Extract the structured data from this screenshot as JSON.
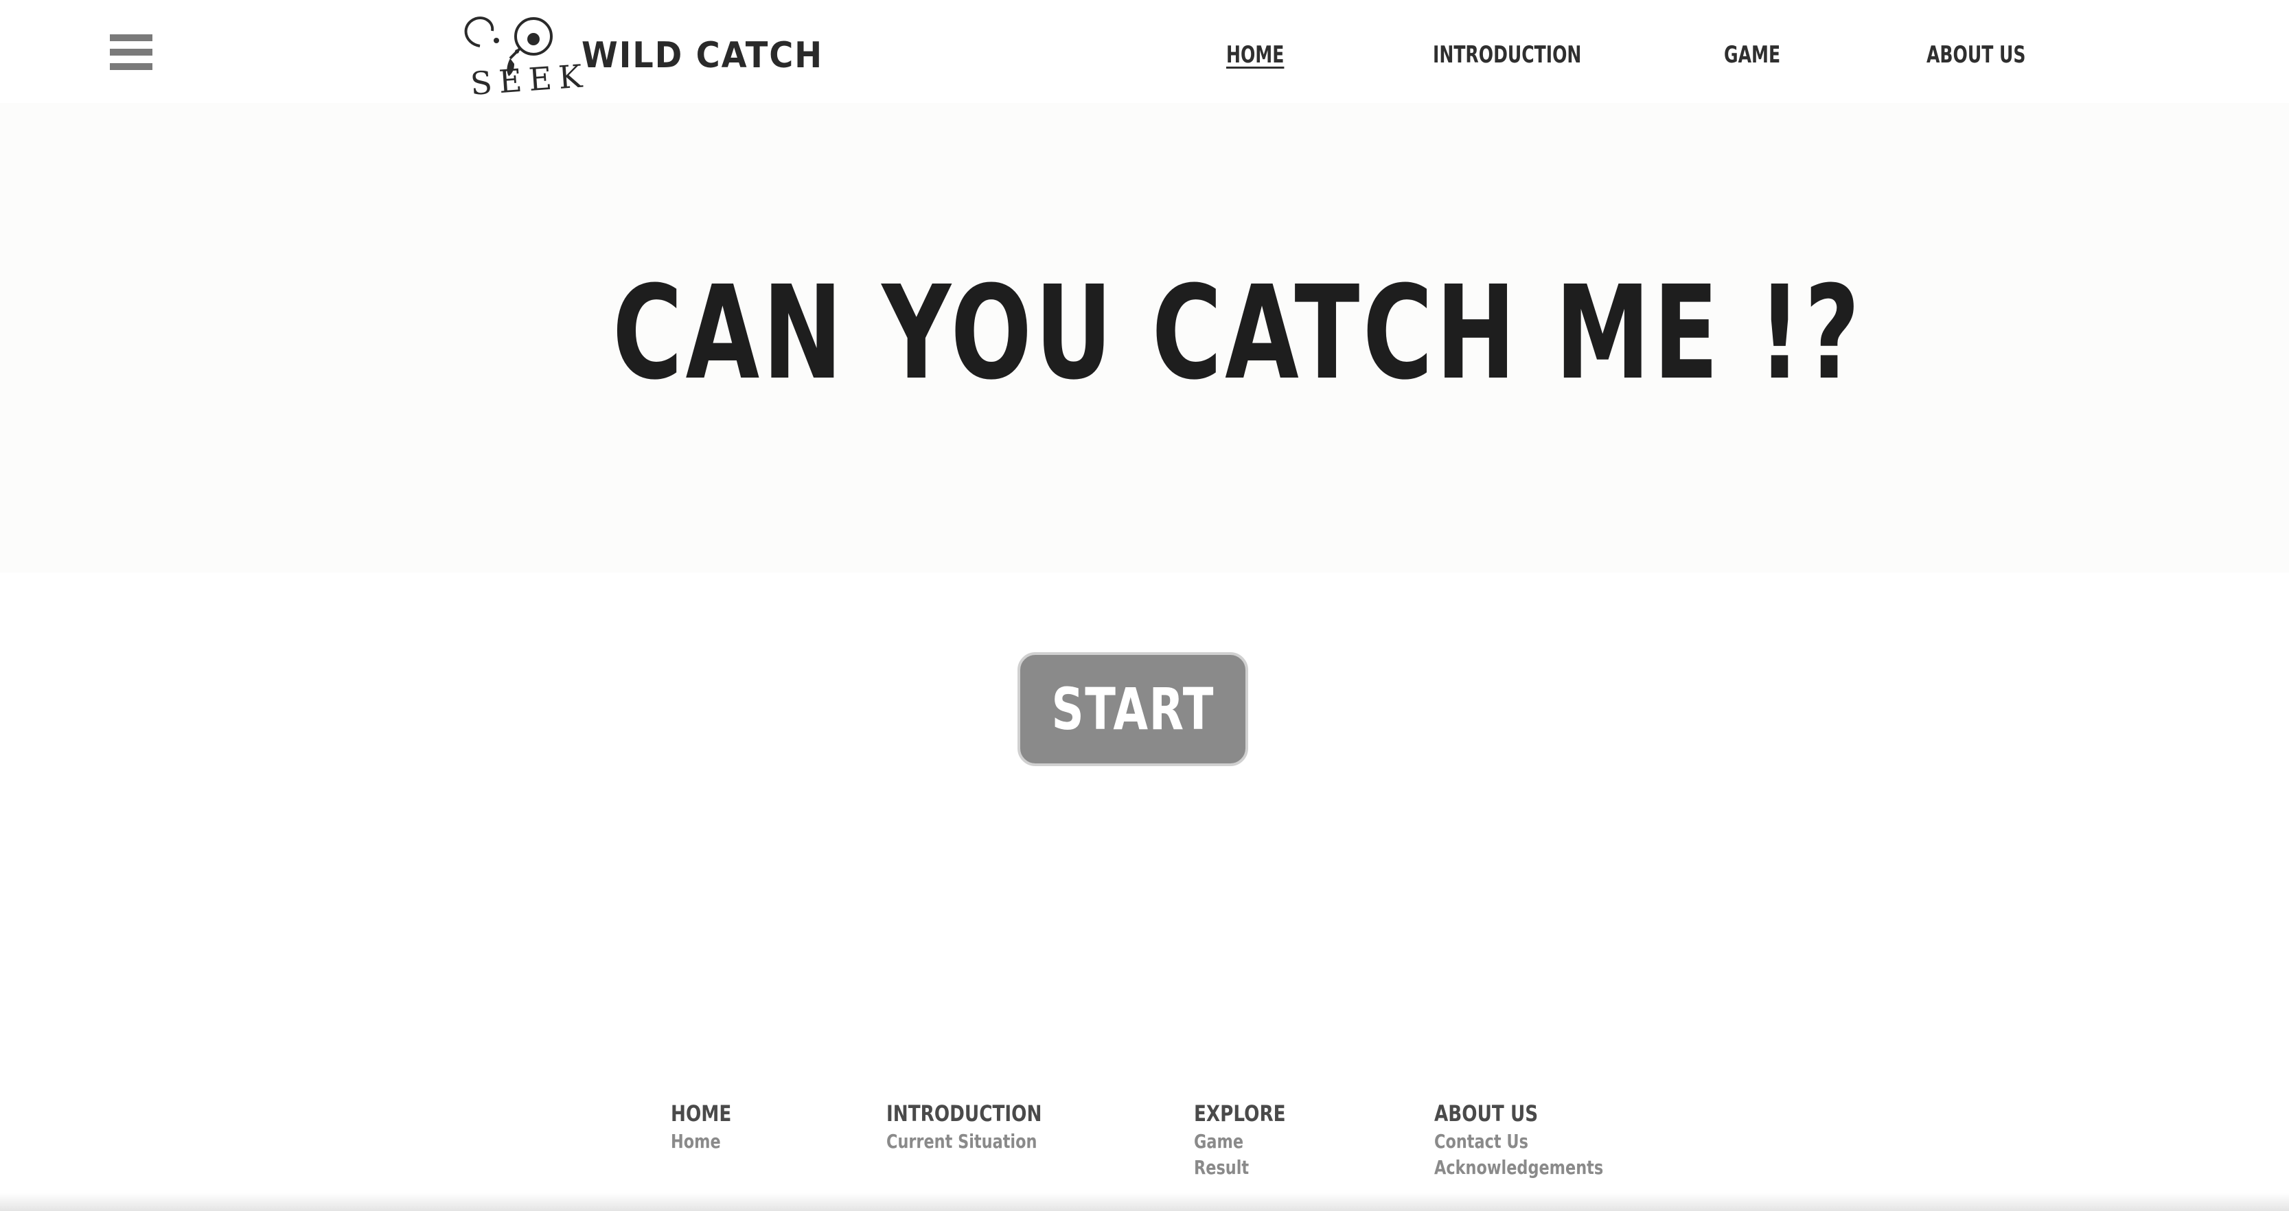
{
  "header": {
    "logo": {
      "mark_text": "SEEK",
      "brand": "WILD CATCH"
    },
    "menu_icon": "hamburger-menu-icon",
    "nav": [
      {
        "label": "HOME",
        "active": true
      },
      {
        "label": "INTRODUCTION",
        "active": false
      },
      {
        "label": "GAME",
        "active": false
      },
      {
        "label": "ABOUT US",
        "active": false
      }
    ]
  },
  "hero": {
    "title": "CAN YOU CATCH ME !?"
  },
  "start_button": {
    "label": "START"
  },
  "footer": {
    "columns": [
      {
        "heading": "HOME",
        "links": [
          "Home"
        ]
      },
      {
        "heading": "INTRODUCTION",
        "links": [
          "Current Situation"
        ]
      },
      {
        "heading": "EXPLORE",
        "links": [
          "Game",
          "Result"
        ]
      },
      {
        "heading": "ABOUT US",
        "links": [
          "Contact Us",
          "Acknowledgements"
        ]
      }
    ]
  },
  "colors": {
    "text_dark": "#1e1e1e",
    "nav_text": "#2f2f2f",
    "button_bg": "#8a8a8a",
    "hero_bg": "#fcfcfb",
    "footer_heading": "#4a4a4a",
    "footer_link": "#8a8a8a"
  }
}
